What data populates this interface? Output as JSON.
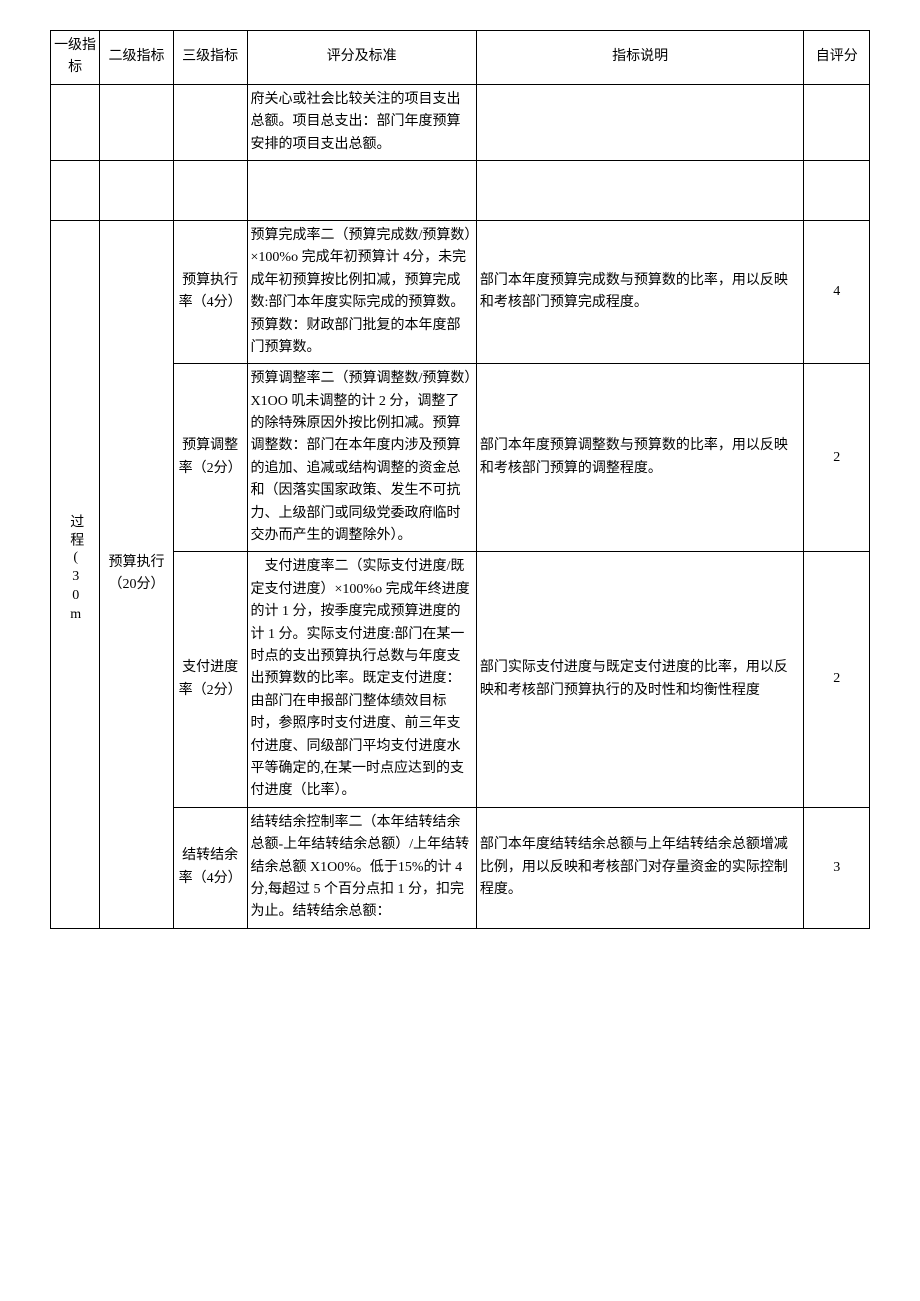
{
  "headers": {
    "col1": "一级指标",
    "col2": "二级指标",
    "col3": "三级指标",
    "col4": "评分及标准",
    "col5": "指标说明",
    "col6": "自评分"
  },
  "carryover_row": {
    "criteria": "府关心或社会比较关注的项目支出总额。项目总支出：部门年度预算安排的项目支出总额。"
  },
  "level1": {
    "label": "过程(30m"
  },
  "level2": {
    "label": "预算执行（20分）"
  },
  "rows": [
    {
      "level3": "预算执行率（4分）",
      "criteria": "预算完成率二（预算完成数/预算数）×100%o 完成年初预算计 4分，未完成年初预算按比例扣减，预算完成数:部门本年度实际完成的预算数。预算数：财政部门批复的本年度部门预算数。",
      "desc": "部门本年度预算完成数与预算数的比率，用以反映和考核部门预算完成程度。",
      "score": "4"
    },
    {
      "level3": "预算调整率（2分）",
      "criteria": "预算调整率二（预算调整数/预算数）X1OO 叽未调整的计 2 分，调整了的除特殊原因外按比例扣减。预算调整数：部门在本年度内涉及预算的追加、追减或结构调整的资金总和（因落实国家政策、发生不可抗力、上级部门或同级党委政府临时交办而产生的调整除外）。",
      "desc": "部门本年度预算调整数与预算数的比率，用以反映和考核部门预算的调整程度。",
      "score": "2"
    },
    {
      "level3": "支付进度率（2分）",
      "criteria": "　支付进度率二（实际支付进度/既定支付进度）×100%o 完成年终进度的计 1 分，按季度完成预算进度的计 1 分。实际支付进度:部门在某一时点的支出预算执行总数与年度支出预算数的比率。既定支付进度：由部门在申报部门整体绩效目标时，参照序时支付进度、前三年支付进度、同级部门平均支付进度水平等确定的,在某一时点应达到的支付进度（比率）。",
      "desc": "部门实际支付进度与既定支付进度的比率，用以反映和考核部门预算执行的及时性和均衡性程度",
      "score": "2"
    },
    {
      "level3": "结转结余率（4分）",
      "criteria": "结转结余控制率二（本年结转结余总额-上年结转结余总额）/上年结转结余总额 X1O0%。低于15%的计 4 分,每超过 5 个百分点扣 1 分，扣完为止。结转结余总额：",
      "desc": "部门本年度结转结余总额与上年结转结余总额增减比例，用以反映和考核部门对存量资金的实际控制程度。",
      "score": "3"
    }
  ]
}
